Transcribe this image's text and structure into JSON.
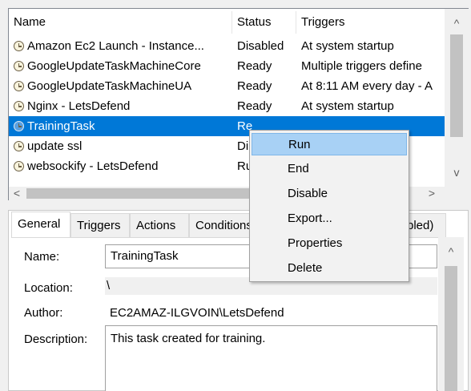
{
  "columns": {
    "name": "Name",
    "status": "Status",
    "triggers": "Triggers"
  },
  "tasks": [
    {
      "name": "Amazon Ec2 Launch - Instance...",
      "status": "Disabled",
      "triggers": "At system startup"
    },
    {
      "name": "GoogleUpdateTaskMachineCore",
      "status": "Ready",
      "triggers": "Multiple triggers define"
    },
    {
      "name": "GoogleUpdateTaskMachineUA",
      "status": "Ready",
      "triggers": "At 8:11 AM every day - A"
    },
    {
      "name": "Nginx - LetsDefend",
      "status": "Ready",
      "triggers": "At system startup"
    },
    {
      "name": "TrainingTask",
      "status": "Re",
      "triggers": ""
    },
    {
      "name": "update ssl",
      "status": "Di",
      "triggers": ""
    },
    {
      "name": "websockify - LetsDefend",
      "status": "Ru",
      "triggers": ""
    }
  ],
  "scroll": {
    "up": "^",
    "down": "v",
    "left": "<",
    "right": ">"
  },
  "tabs": {
    "general": "General",
    "triggers": "Triggers",
    "actions": "Actions",
    "conditions": "Conditions",
    "settings_tail": "bled)"
  },
  "detail": {
    "name_label": "Name:",
    "name_value": "TrainingTask",
    "location_label": "Location:",
    "location_value": "\\",
    "author_label": "Author:",
    "author_value": "EC2AMAZ-ILGVOIN\\LetsDefend",
    "description_label": "Description:",
    "description_value": "This task created for training."
  },
  "context_menu": [
    "Run",
    "End",
    "Disable",
    "Export...",
    "Properties",
    "Delete"
  ]
}
